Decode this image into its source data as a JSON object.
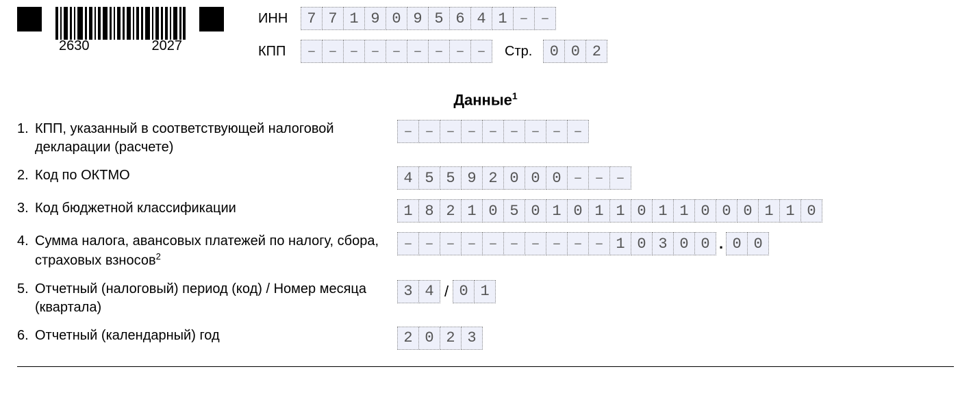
{
  "barcode": {
    "left": "2630",
    "right": "2027"
  },
  "header": {
    "inn_label": "ИНН",
    "kpp_label": "КПП",
    "page_label": "Стр.",
    "inn": [
      "7",
      "7",
      "1",
      "9",
      "0",
      "9",
      "5",
      "6",
      "4",
      "1",
      "–",
      "–"
    ],
    "kpp": [
      "–",
      "–",
      "–",
      "–",
      "–",
      "–",
      "–",
      "–",
      "–"
    ],
    "page": [
      "0",
      "0",
      "2"
    ]
  },
  "section_title": "Данные",
  "section_footnote": "1",
  "rows": {
    "r1": {
      "num": "1.",
      "label": "КПП, указанный в соответствующей налоговой декларации (расчете)",
      "cells": [
        "–",
        "–",
        "–",
        "–",
        "–",
        "–",
        "–",
        "–",
        "–"
      ]
    },
    "r2": {
      "num": "2.",
      "label": "Код по ОКТМО",
      "cells": [
        "4",
        "5",
        "5",
        "9",
        "2",
        "0",
        "0",
        "0",
        "–",
        "–",
        "–"
      ]
    },
    "r3": {
      "num": "3.",
      "label": "Код бюджетной классификации",
      "cells": [
        "1",
        "8",
        "2",
        "1",
        "0",
        "5",
        "0",
        "1",
        "0",
        "1",
        "1",
        "0",
        "1",
        "1",
        "0",
        "0",
        "0",
        "1",
        "1",
        "0"
      ]
    },
    "r4": {
      "num": "4.",
      "label": "Сумма налога, авансовых платежей по налогу, сбора, страховых взносов",
      "footnote": "2",
      "int_cells": [
        "–",
        "–",
        "–",
        "–",
        "–",
        "–",
        "–",
        "–",
        "–",
        "–",
        "1",
        "0",
        "3",
        "0",
        "0"
      ],
      "dec_cells": [
        "0",
        "0"
      ]
    },
    "r5": {
      "num": "5.",
      "label": "Отчетный (налоговый) период (код) / Номер месяца (квартала)",
      "cells_a": [
        "3",
        "4"
      ],
      "cells_b": [
        "0",
        "1"
      ]
    },
    "r6": {
      "num": "6.",
      "label": "Отчетный (календарный) год",
      "cells": [
        "2",
        "0",
        "2",
        "3"
      ]
    }
  }
}
